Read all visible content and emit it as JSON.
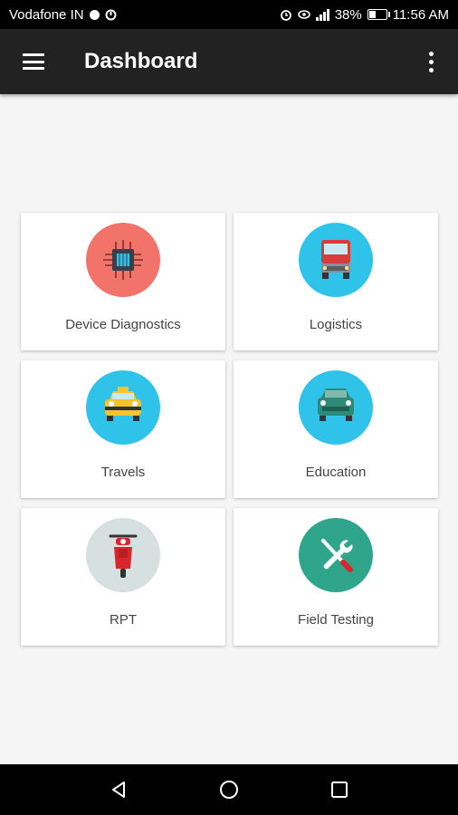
{
  "status_bar": {
    "carrier": "Vodafone IN",
    "battery": "38%",
    "battery_level": 0.38,
    "time": "11:56 AM"
  },
  "app_bar": {
    "title": "Dashboard",
    "menu_icon": "hamburger-menu-icon",
    "more_icon": "more-vert-icon"
  },
  "tiles": [
    {
      "label": "Device Diagnostics",
      "icon": "chip-icon",
      "color": "#f2736a"
    },
    {
      "label": "Logistics",
      "icon": "truck-icon",
      "color": "#2fc3ea"
    },
    {
      "label": "Travels",
      "icon": "taxi-icon",
      "color": "#2fc3ea"
    },
    {
      "label": "Education",
      "icon": "van-icon",
      "color": "#2fc3ea"
    },
    {
      "label": "RPT",
      "icon": "scooter-icon",
      "color": "#d6e0e0"
    },
    {
      "label": "Field Testing",
      "icon": "tools-icon",
      "color": "#2fa58c"
    }
  ],
  "nav_bar": {
    "back_icon": "back-triangle-icon",
    "home_icon": "home-circle-icon",
    "recents_icon": "recents-square-icon"
  }
}
